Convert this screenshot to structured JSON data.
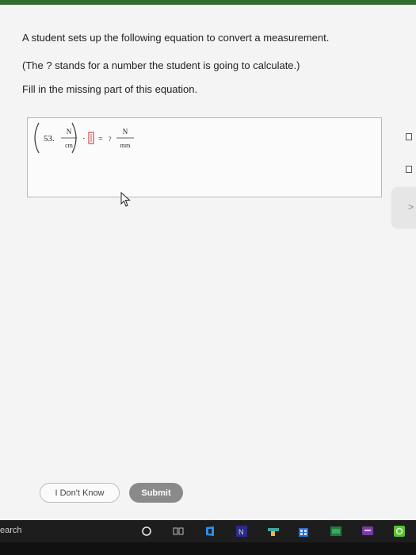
{
  "question": {
    "line1": "A student sets up the following equation to convert a measurement.",
    "line2": "(The ? stands for a number the student is going to calculate.)",
    "line3": "Fill in the missing part of this equation."
  },
  "equation": {
    "coefficient": "53.",
    "numerator_unit": "N",
    "denominator_unit": "cm",
    "multiply_sign": "·",
    "equals_sign": "=",
    "unknown": "?",
    "result_numerator_unit": "N",
    "result_denominator_unit": "mm"
  },
  "side_tab": {
    "chevron": ">"
  },
  "buttons": {
    "dont_know": "I Don't Know",
    "submit": "Submit"
  },
  "taskbar": {
    "search_text": "earch"
  },
  "colors": {
    "submit_bg": "#8a8a8a",
    "taskbar_bg": "#1d1d1d",
    "accent_red": "#c2272d"
  }
}
